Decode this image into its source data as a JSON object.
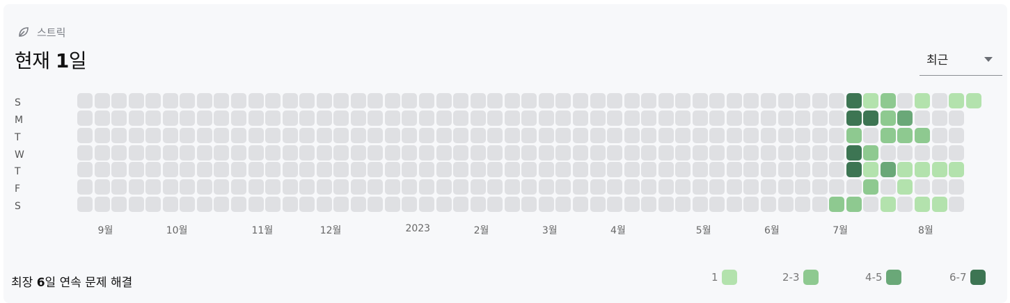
{
  "header": {
    "label": "스트릭",
    "icon": "leaf-icon"
  },
  "current": {
    "prefix": "현재 ",
    "value": "1",
    "suffix": "일"
  },
  "period_select": {
    "value": "최근"
  },
  "day_labels": [
    "S",
    "M",
    "T",
    "W",
    "T",
    "F",
    "S"
  ],
  "month_labels": [
    {
      "label": "9월",
      "week": 1
    },
    {
      "label": "10월",
      "week": 5
    },
    {
      "label": "11월",
      "week": 10
    },
    {
      "label": "12월",
      "week": 14
    },
    {
      "label": "2023",
      "week": 19
    },
    {
      "label": "2월",
      "week": 23
    },
    {
      "label": "3월",
      "week": 27
    },
    {
      "label": "4월",
      "week": 31
    },
    {
      "label": "5월",
      "week": 36
    },
    {
      "label": "6월",
      "week": 40
    },
    {
      "label": "7월",
      "week": 44
    },
    {
      "label": "8월",
      "week": 49
    }
  ],
  "weeks": 53,
  "last_week_days": 1,
  "colors": {
    "0": "#dfe0e3",
    "1": "#b3e2ad",
    "2": "#8ec990",
    "3": "#6aa878",
    "4": "#3d7553"
  },
  "active_cells": [
    {
      "week": 44,
      "day": 6,
      "level": 2
    },
    {
      "week": 45,
      "day": 0,
      "level": 4
    },
    {
      "week": 45,
      "day": 1,
      "level": 4
    },
    {
      "week": 45,
      "day": 2,
      "level": 2
    },
    {
      "week": 45,
      "day": 3,
      "level": 4
    },
    {
      "week": 45,
      "day": 4,
      "level": 4
    },
    {
      "week": 45,
      "day": 6,
      "level": 2
    },
    {
      "week": 46,
      "day": 0,
      "level": 1
    },
    {
      "week": 46,
      "day": 1,
      "level": 4
    },
    {
      "week": 46,
      "day": 3,
      "level": 2
    },
    {
      "week": 46,
      "day": 4,
      "level": 1
    },
    {
      "week": 46,
      "day": 5,
      "level": 2
    },
    {
      "week": 47,
      "day": 0,
      "level": 2
    },
    {
      "week": 47,
      "day": 1,
      "level": 2
    },
    {
      "week": 47,
      "day": 2,
      "level": 2
    },
    {
      "week": 47,
      "day": 4,
      "level": 3
    },
    {
      "week": 47,
      "day": 6,
      "level": 1
    },
    {
      "week": 48,
      "day": 1,
      "level": 3
    },
    {
      "week": 48,
      "day": 2,
      "level": 2
    },
    {
      "week": 48,
      "day": 4,
      "level": 1
    },
    {
      "week": 48,
      "day": 5,
      "level": 1
    },
    {
      "week": 49,
      "day": 0,
      "level": 1
    },
    {
      "week": 49,
      "day": 2,
      "level": 2
    },
    {
      "week": 49,
      "day": 4,
      "level": 1
    },
    {
      "week": 49,
      "day": 6,
      "level": 1
    },
    {
      "week": 50,
      "day": 4,
      "level": 1
    },
    {
      "week": 50,
      "day": 6,
      "level": 1
    },
    {
      "week": 51,
      "day": 0,
      "level": 1
    },
    {
      "week": 51,
      "day": 4,
      "level": 1
    },
    {
      "week": 52,
      "day": 0,
      "level": 1
    }
  ],
  "footer": {
    "prefix": "최장 ",
    "value": "6",
    "suffix": "일 연속 문제 해결"
  },
  "legend": [
    {
      "label": "1",
      "level": 1
    },
    {
      "label": "2-3",
      "level": 2
    },
    {
      "label": "4-5",
      "level": 3
    },
    {
      "label": "6-7",
      "level": 4
    }
  ]
}
